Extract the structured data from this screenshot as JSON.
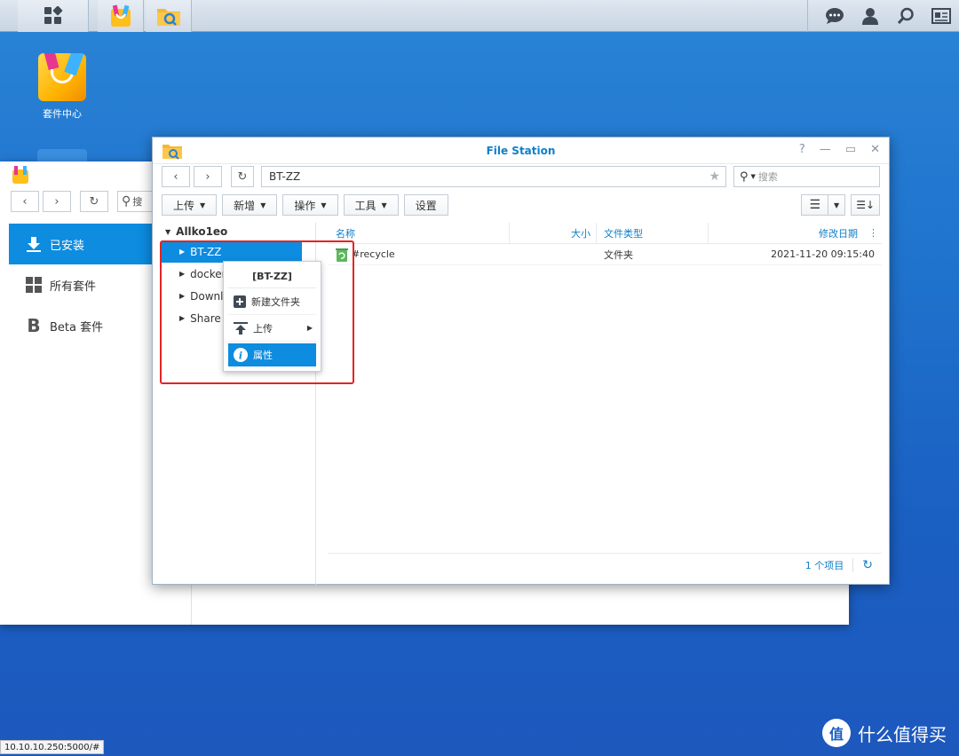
{
  "taskbar": {
    "main_menu": "main-menu-icon",
    "apps": [
      "package-center-icon",
      "file-station-icon"
    ],
    "right_icons": [
      "chat-icon",
      "user-icon",
      "search-icon",
      "widgets-icon"
    ]
  },
  "desktop": {
    "icon_label": "套件中心"
  },
  "package_center": {
    "search_placeholder": "搜",
    "sidebar": [
      {
        "label": "已安装",
        "icon": "download-icon"
      },
      {
        "label": "所有套件",
        "icon": "grid-icon"
      },
      {
        "label": "Beta 套件",
        "icon": "beta-icon"
      }
    ]
  },
  "file_station": {
    "title": "File Station",
    "path": "BT-ZZ",
    "search_placeholder": "搜索",
    "toolbar": {
      "upload": "上传",
      "create": "新增",
      "action": "操作",
      "tools": "工具",
      "settings": "设置"
    },
    "tree": {
      "root": "Allko1eo",
      "items": [
        "BT-ZZ",
        "docker",
        "Downlo",
        "Share"
      ]
    },
    "columns": {
      "name": "名称",
      "size": "大小",
      "type": "文件类型",
      "modified": "修改日期"
    },
    "rows": [
      {
        "name": "#recycle",
        "size": "",
        "type": "文件夹",
        "modified": "2021-11-20 09:15:40"
      }
    ],
    "footer": {
      "count": "1 个项目"
    }
  },
  "context_menu": {
    "header": "[BT-ZZ]",
    "items": [
      "新建文件夹",
      "上传",
      "属性"
    ]
  },
  "status": {
    "url": "10.10.10.250:5000/#"
  },
  "watermark": {
    "logo": "值",
    "text": "什么值得买"
  }
}
